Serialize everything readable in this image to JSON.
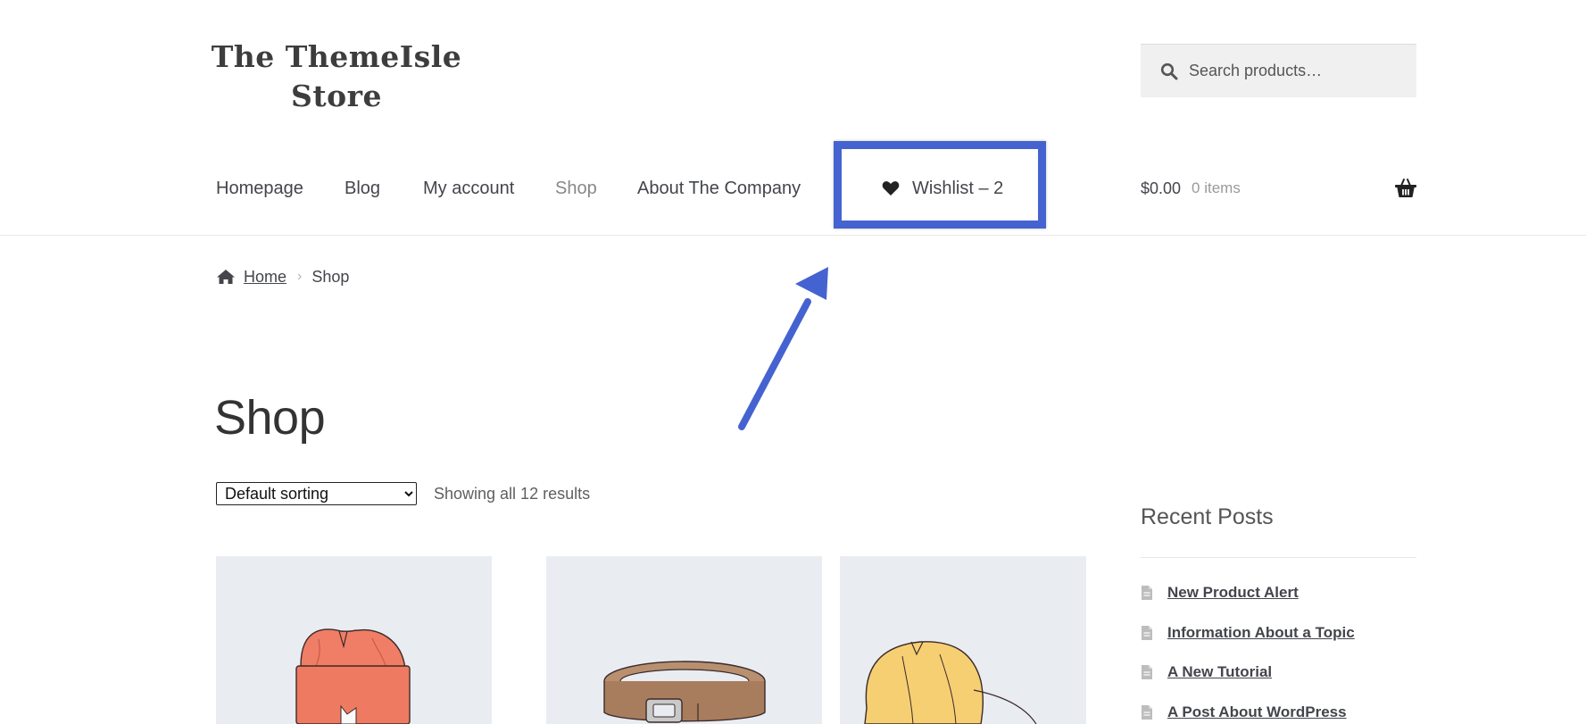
{
  "site": {
    "title_line1": "The ThemeIsle",
    "title_line2": "Store"
  },
  "search": {
    "placeholder": "Search products…",
    "icon": "search-icon"
  },
  "nav": {
    "items": [
      {
        "label": "Homepage"
      },
      {
        "label": "Blog"
      },
      {
        "label": "My account"
      },
      {
        "label": "Shop",
        "current": true
      },
      {
        "label": "About The Company"
      }
    ],
    "wishlist": {
      "label": "Wishlist – 2",
      "icon": "heart-icon"
    }
  },
  "cart": {
    "amount": "$0.00",
    "count": "0 items",
    "icon": "basket-icon"
  },
  "breadcrumb": {
    "home": "Home",
    "current": "Shop",
    "icon": "home-icon"
  },
  "page": {
    "title": "Shop"
  },
  "sorting": {
    "selected": "Default sorting"
  },
  "results": {
    "text": "Showing all 12 results"
  },
  "products": [
    {
      "name": "beanie",
      "icon": "beanie-image"
    },
    {
      "name": "belt",
      "icon": "belt-image"
    },
    {
      "name": "cap",
      "icon": "cap-image"
    }
  ],
  "sidebar": {
    "widget_title": "Recent Posts",
    "posts": [
      {
        "title": "New Product Alert"
      },
      {
        "title": "Information About a Topic"
      },
      {
        "title": "A New Tutorial"
      },
      {
        "title": "A Post About WordPress"
      }
    ]
  },
  "colors": {
    "highlight": "#4563d0",
    "text": "#43454b",
    "product_bg": "#e9ecf1"
  }
}
